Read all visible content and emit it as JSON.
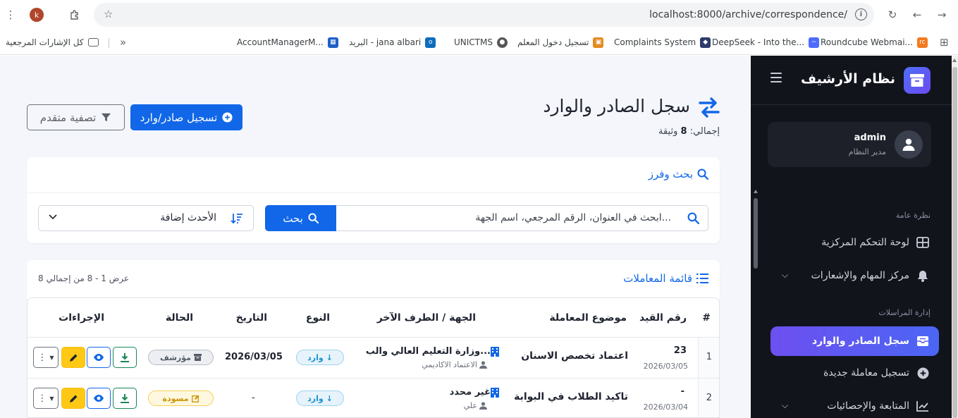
{
  "browser": {
    "profile_initial": "k",
    "url": "localhost:8000/archive/correspondence/",
    "bookmarks": [
      {
        "label": "Roundcube Webmai...",
        "icon": "roundcube-icon",
        "color": "#f47b20"
      },
      {
        "label": "DeepSeek - Into the...",
        "icon": "deepseek-icon",
        "color": "#4d6bfe"
      },
      {
        "label": "Complaints System",
        "icon": "shield-icon",
        "color": "#2d3a6b"
      },
      {
        "label": "تسجيل دخول المعلم",
        "icon": "teacher-login-icon",
        "color": "#e58a1f"
      },
      {
        "label": "UNICTMS",
        "icon": "globe-icon",
        "color": "#555555"
      },
      {
        "label": "البريد - jana albari",
        "icon": "outlook-icon",
        "color": "#0f6cbd"
      },
      {
        "label": "AccountManagerM...",
        "icon": "grid-icon",
        "color": "#1e5fc7"
      },
      {
        "label": "كل الإشارات المرجعية",
        "icon": "folder-icon",
        "color": "#5f6368"
      }
    ]
  },
  "sidebar": {
    "app_title": "نظام الأرشيف",
    "user": {
      "name": "admin",
      "role": "مدير النظام"
    },
    "sections": [
      {
        "title": "نظرة عامة"
      },
      {
        "title": "إدارة المراسلات"
      }
    ],
    "items": [
      {
        "label": "لوحة التحكم المركزية"
      },
      {
        "label": "مركز المهام والإشعارات"
      },
      {
        "label": "سجل الصادر والوارد"
      },
      {
        "label": "تسجيل معاملة جديدة"
      },
      {
        "label": "المتابعة والإحصائيات"
      }
    ]
  },
  "page": {
    "title": "سجل الصادر والوارد",
    "total_label": "إجمالي:",
    "total_count": "8",
    "total_unit": "وثيقة",
    "register_button": "تسجيل صادر/وارد",
    "filter_button": "تصفية متقدم"
  },
  "search": {
    "heading": "بحث وفرز",
    "placeholder": "ابحث في العنوان، الرقم المرجعي، اسم الجهة...",
    "button": "بحث",
    "sort_value": "الأحدث إضافة"
  },
  "list": {
    "heading": "قائمة المعاملات",
    "count_text": "عرض 1 - 8 من إجمالي 8"
  },
  "table": {
    "columns": [
      "#",
      "رقم القيد",
      "موضوع المعاملة",
      "الجهة / الطرف الآخر",
      "النوع",
      "التاريخ",
      "الحالة",
      "الإجراءات"
    ],
    "rows": [
      {
        "num": "1",
        "reg_no": "23",
        "reg_date": "2026/03/05",
        "subject": "اعتماد تخصص الاسنان",
        "party": "وزارة التعليم العالي والب...",
        "party_sub": "الاعتماد الاكاديمي",
        "type": "وارد",
        "date": "2026/03/05",
        "status": "مؤرشف"
      },
      {
        "num": "2",
        "reg_no": "-",
        "reg_date": "2026/03/04",
        "subject": "تاكيد الطلاب في البوابة",
        "party": "غير محدد",
        "party_sub": "علي",
        "type": "وارد",
        "date": "-",
        "status": "مسودة"
      }
    ]
  },
  "colors": {
    "primary": "#1167e8",
    "sidebar_bg": "#12141c",
    "active_item_gradient_start": "#6d4ff0",
    "active_item_gradient_end": "#4b66f4",
    "success": "#198754",
    "warning": "#ffc814"
  }
}
